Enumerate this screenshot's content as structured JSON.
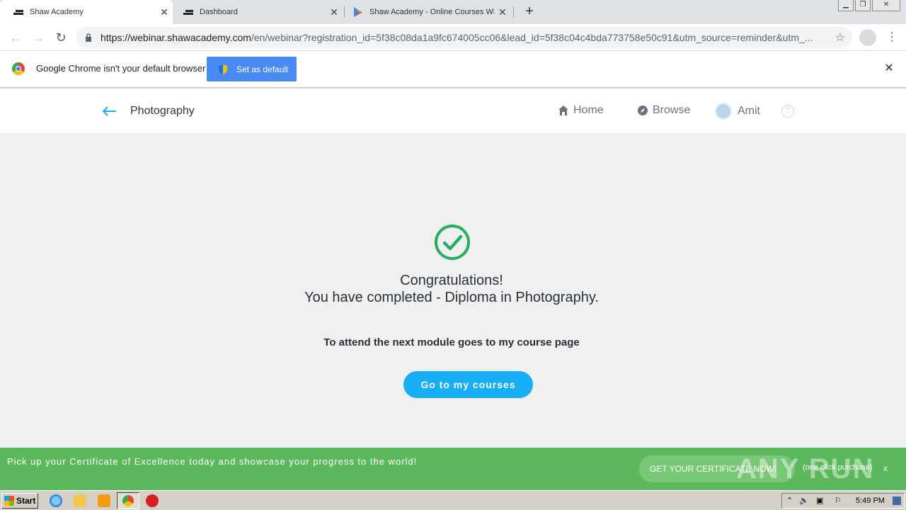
{
  "browser": {
    "tabs": [
      {
        "title": "Shaw Academy",
        "active": true
      },
      {
        "title": "Dashboard",
        "active": false
      },
      {
        "title": "Shaw Academy - Online Courses With",
        "active": false
      }
    ],
    "url_host": "https://webinar.shawacademy.com",
    "url_path": "/en/webinar?registration_id=5f38c08da1a9fc674005cc06&lead_id=5f38c04c4bda773758e50c91&utm_source=reminder&utm_..."
  },
  "infobar": {
    "message": "Google Chrome isn't your default browser",
    "button_label": "Set as default"
  },
  "header": {
    "course": "Photography",
    "nav": {
      "home": "Home",
      "browse": "Browse",
      "user": "Amit"
    }
  },
  "main": {
    "congrats_line1": "Congratulations!",
    "congrats_line2": "You have completed - Diploma in Photography.",
    "instruction": "To attend the next module goes to my course page",
    "button_label": "Go to my courses"
  },
  "banner": {
    "text": "Pick up your Certificate of Excellence today and showcase your progress to the world!",
    "button_label": "GET YOUR CERTIFICATE NOW!",
    "note": "(one click purchase)",
    "close": "x",
    "watermark": "ANY RUN"
  },
  "taskbar": {
    "start_label": "Start",
    "clock": "5:49 PM"
  },
  "colors": {
    "accent_blue": "#17aef5",
    "success_green": "#27ae60",
    "banner_green": "#5cb85c"
  }
}
